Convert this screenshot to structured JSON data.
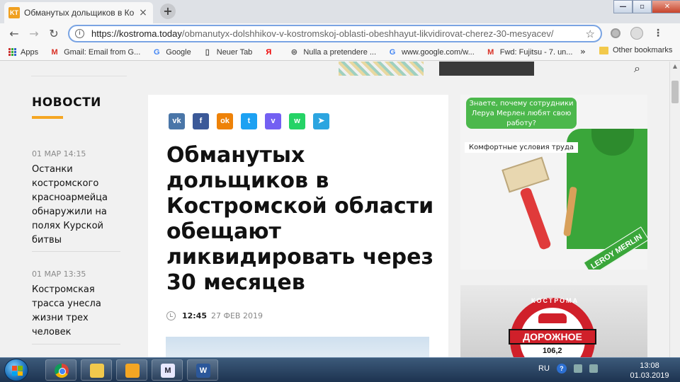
{
  "browser": {
    "tab": {
      "favicon": "KT",
      "title": "Обманутых дольщиков в Костр",
      "close": "×"
    },
    "newtab": "+",
    "window_controls": {
      "minimize": "—",
      "maximize": "▫",
      "close": "✕"
    },
    "nav": {
      "back": "←",
      "forward": "→",
      "reload": "↻"
    },
    "url": {
      "host": "https://kostroma.today",
      "path": "/obmanutyx-dolshhikov-v-kostromskoj-oblasti-obeshhayut-likvidirovat-cherez-30-mesyacev/"
    },
    "star": "☆",
    "menu": "⋮",
    "bookmarks": [
      {
        "icon": "apps",
        "label": "Apps",
        "color": "#c33"
      },
      {
        "icon": "M",
        "label": "Gmail: Email from G...",
        "color": "#d93025"
      },
      {
        "icon": "G",
        "label": "Google",
        "color": "#4285f4"
      },
      {
        "icon": "▯",
        "label": "Neuer Tab",
        "color": "#555"
      },
      {
        "icon": "Я",
        "label": "",
        "color": "#e00"
      },
      {
        "icon": "⊜",
        "label": "Nulla a pretendere ...",
        "color": "#666"
      },
      {
        "icon": "G",
        "label": "www.google.com/w...",
        "color": "#4285f4"
      },
      {
        "icon": "M",
        "label": "Fwd: Fujitsu - 7. un...",
        "color": "#d93025"
      }
    ],
    "bookmarks_more": "»",
    "other_bookmarks": "Other bookmarks"
  },
  "news": {
    "heading": "НОВОСТИ",
    "accent_color": "#f5a623",
    "items": [
      {
        "time": "01 МАР 14:15",
        "text": "Останки костромского красноармейца обнаружили на полях Курской битвы"
      },
      {
        "time": "01 МАР 13:35",
        "text": "Костромская трасса унесла жизни трех человек"
      }
    ]
  },
  "article": {
    "share": [
      {
        "name": "vk",
        "label": "vk",
        "color": "#4a76a8"
      },
      {
        "name": "facebook",
        "label": "f",
        "color": "#3b5998"
      },
      {
        "name": "odnoklassniki",
        "label": "ok",
        "color": "#ee8208"
      },
      {
        "name": "twitter",
        "label": "t",
        "color": "#1da1f2"
      },
      {
        "name": "viber",
        "label": "v",
        "color": "#7360f2"
      },
      {
        "name": "whatsapp",
        "label": "w",
        "color": "#25d366"
      },
      {
        "name": "telegram",
        "label": "➤",
        "color": "#2ca5e0"
      }
    ],
    "headline": "Обманутых дольщиков в Костромской области обещают ликвидировать через 30 месяцев",
    "time": "12:45",
    "date": "27 ФЕВ 2019"
  },
  "ads": {
    "leroy": {
      "bubble": "Знаете, почему сотрудники Леруа Мерлен любят свою работу?",
      "tag": "Комфортные условия труда",
      "logo": "LEROY MERLIN"
    },
    "radio": {
      "arc": "КОСТРОМА",
      "banner": "ДОРОЖНОЕ",
      "freq": "106,2"
    }
  },
  "taskbar": {
    "lang": "RU",
    "help": "?",
    "time": "13:08",
    "date": "01.03.2019"
  }
}
